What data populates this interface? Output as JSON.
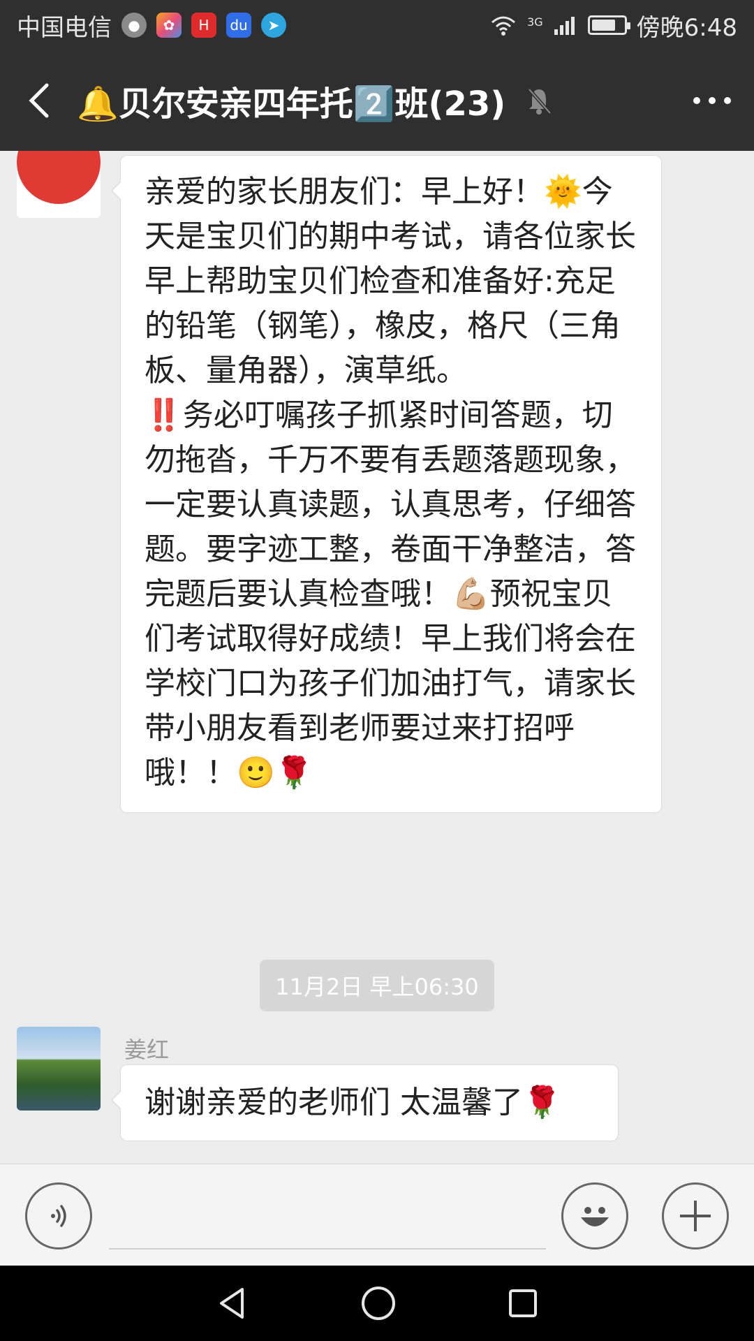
{
  "status_bar": {
    "carrier": "中国电信",
    "network": "3G",
    "time": "傍晚6:48",
    "battery_level": 0.75
  },
  "header": {
    "title": "🔔贝尔安亲四年托2️⃣班(23)",
    "icons": [
      "back-arrow-icon",
      "mute-bell-icon",
      "more-icon"
    ]
  },
  "messages": [
    {
      "avatar": "angel-bell-logo",
      "paragraphs": [
        "亲爱的家长朋友们：早上好！🌞今天是宝贝们的期中考试，请各位家长早上帮助宝贝们检查和准备好:充足的铅笔（钢笔），橡皮，格尺（三角板、量角器），演草纸。",
        "‼️务必叮嘱孩子抓紧时间答题，切勿拖沓，千万不要有丢题落题现象，一定要认真读题，认真思考，仔细答题。要字迹工整，卷面干净整洁，答完题后要认真检查哦！💪🏼预祝宝贝们考试取得好成绩！早上我们将会在学校门口为孩子们加油打气，请家长带小朋友看到老师要过来打招呼哦！！🙂🌹"
      ]
    }
  ],
  "timestamp": "11月2日 早上06:30",
  "reply": {
    "sender": "姜红",
    "text": "谢谢亲爱的老师们 太温馨了🌹"
  },
  "input_bar": {
    "icons": [
      "voice-icon",
      "emoji-icon",
      "plus-icon"
    ]
  },
  "nav_bar": {
    "icons": [
      "nav-back-icon",
      "nav-home-icon",
      "nav-recents-icon"
    ]
  },
  "colors": {
    "header_bg": "#2f2f2f",
    "chat_bg": "#ececec",
    "bubble_bg": "#ffffff",
    "time_chip_bg": "#d6d6d6"
  }
}
